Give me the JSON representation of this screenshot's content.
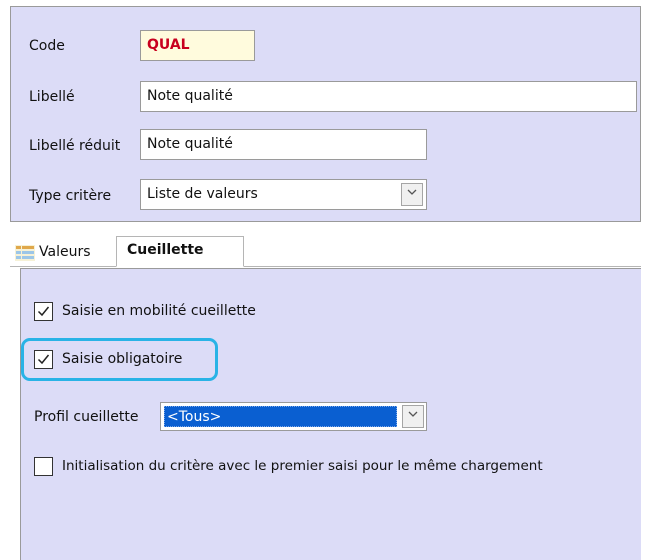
{
  "form": {
    "code_label": "Code",
    "code_value": "QUAL",
    "libelle_label": "Libellé",
    "libelle_value": "Note qualité",
    "libelle_reduit_label": "Libellé réduit",
    "libelle_reduit_value": "Note qualité",
    "type_critere_label": "Type critère",
    "type_critere_value": "Liste de valeurs"
  },
  "tabs": [
    {
      "label": "Valeurs",
      "icon": "grid-list-icon",
      "active": false
    },
    {
      "label": "Cueillette",
      "active": true
    }
  ],
  "cueillette": {
    "mobilite_label": "Saisie en mobilité cueillette",
    "mobilite_checked": true,
    "obligatoire_label": "Saisie obligatoire",
    "obligatoire_checked": true,
    "profil_label": "Profil cueillette",
    "profil_value": "<Tous>",
    "initialisation_label": "Initialisation du critère avec le premier saisi pour le même chargement",
    "initialisation_checked": false
  },
  "colors": {
    "panel_bg": "#dcdcf7",
    "code_text": "#c8001e",
    "highlight": "#29b3e6",
    "selection": "#0a5fd1"
  }
}
